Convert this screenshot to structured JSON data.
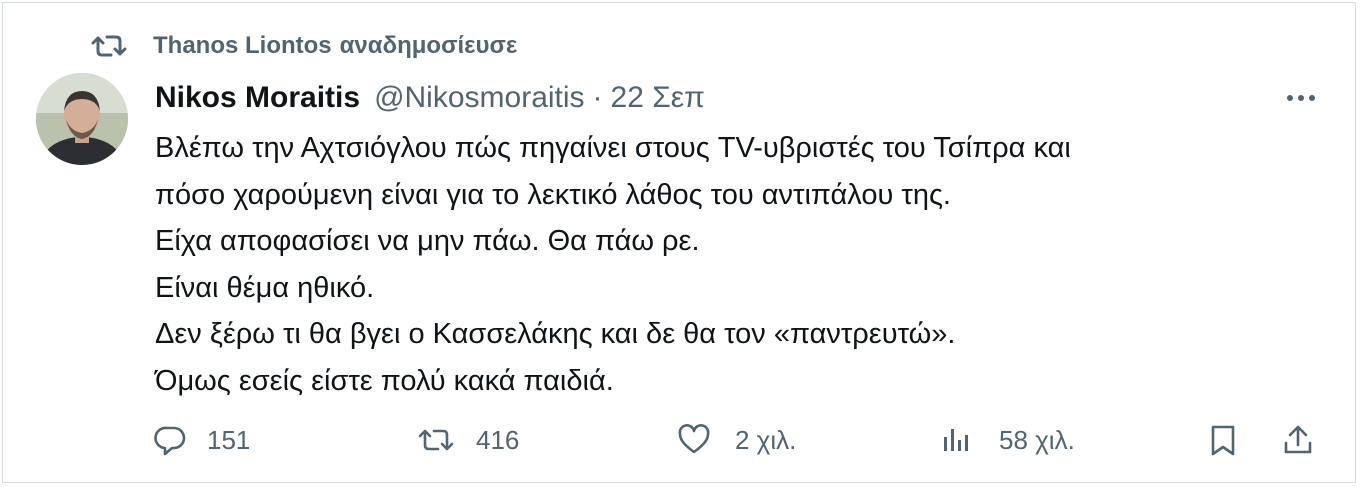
{
  "repost": {
    "user": "Thanos Liontos",
    "action": "αναδημοσίευσε"
  },
  "tweet": {
    "author_name": "Nikos Moraitis",
    "handle": "@Nikosmoraitis",
    "separator": "·",
    "date": "22 Σεπ",
    "lines": [
      "Βλέπω την Αχτσιόγλου πώς πηγαίνει στους TV-υβριστές του Τσίπρα και",
      "πόσο χαρούμενη είναι για το λεκτικό λάθος του αντιπάλου της.",
      "Είχα αποφασίσει να μην πάω. Θα πάω ρε.",
      "Είναι θέμα ηθικό.",
      "Δεν ξέρω τι θα βγει ο Κασσελάκης και δε θα τον «παντρευτώ».",
      "Όμως εσείς είστε πολύ κακά παιδιά."
    ]
  },
  "actions": {
    "replies": "151",
    "reposts": "416",
    "likes": "2 χιλ.",
    "views": "58 χιλ."
  },
  "icons": {
    "repost_header": "repost-icon",
    "more": "more-icon",
    "reply": "reply-icon",
    "repost": "repost-icon",
    "like": "heart-icon",
    "views": "views-icon",
    "bookmark": "bookmark-icon",
    "share": "share-icon"
  },
  "colors": {
    "text": "#0f1419",
    "secondary": "#536471",
    "border": "#d6dbdf"
  }
}
